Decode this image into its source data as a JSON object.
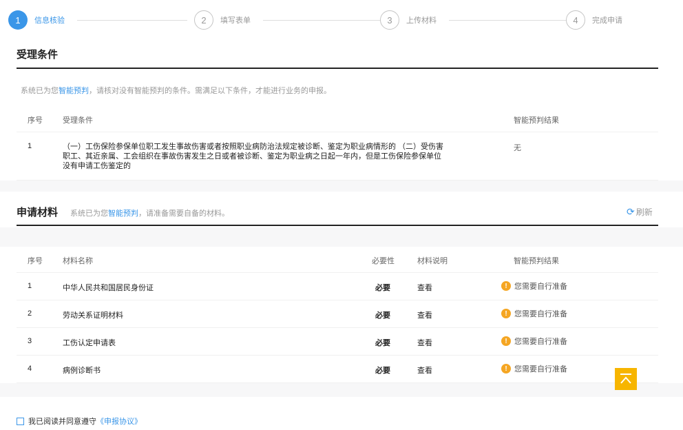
{
  "steps": [
    {
      "num": "1",
      "label": "信息核验",
      "state": "active"
    },
    {
      "num": "2",
      "label": "填写表单",
      "state": "pending"
    },
    {
      "num": "3",
      "label": "上传材料",
      "state": "pending"
    },
    {
      "num": "4",
      "label": "完成申请",
      "state": "pending"
    }
  ],
  "conditions": {
    "title": "受理条件",
    "hint_prefix": "系统已为您",
    "hint_link": "智能预判",
    "hint_suffix": "，请核对没有智能预判的条件。需满足以下条件，才能进行业务的申报。",
    "headers": {
      "num": "序号",
      "condition": "受理条件",
      "result": "智能预判结果"
    },
    "rows": [
      {
        "num": "1",
        "text": "（一）工伤保险参保单位职工发生事故伤害或者按照职业病防治法规定被诊断、鉴定为职业病情形的 （二）受伤害职工、其近亲属、工会组织在事故伤害发生之日或者被诊断、鉴定为职业病之日起一年内，但是工伤保险参保单位没有申请工伤鉴定的",
        "result": "无"
      }
    ]
  },
  "materials": {
    "title": "申请材料",
    "hint_prefix": "系统已为您",
    "hint_link": "智能预判",
    "hint_suffix": "，请准备需要自备的材料。",
    "refresh_label": "刷新",
    "headers": {
      "num": "序号",
      "name": "材料名称",
      "required": "必要性",
      "desc": "材料说明",
      "result": "智能预判结果"
    },
    "rows": [
      {
        "num": "1",
        "name": "中华人民共和国居民身份证",
        "required": "必要",
        "desc": "查看",
        "result": "您需要自行准备"
      },
      {
        "num": "2",
        "name": "劳动关系证明材料",
        "required": "必要",
        "desc": "查看",
        "result": "您需要自行准备"
      },
      {
        "num": "3",
        "name": "工伤认定申请表",
        "required": "必要",
        "desc": "查看",
        "result": "您需要自行准备"
      },
      {
        "num": "4",
        "name": "病例诊断书",
        "required": "必要",
        "desc": "查看",
        "result": "您需要自行准备"
      }
    ]
  },
  "agreement": {
    "prefix": "我已阅读并同意遵守",
    "link": "《申报协议》"
  },
  "colors": {
    "accent": "#3a96e8",
    "warning": "#f5a623",
    "back_top": "#f7b500"
  },
  "icons": {
    "warning": "exclamation-circle-icon",
    "refresh": "refresh-icon",
    "back_top": "arrow-up-to-top-icon"
  }
}
